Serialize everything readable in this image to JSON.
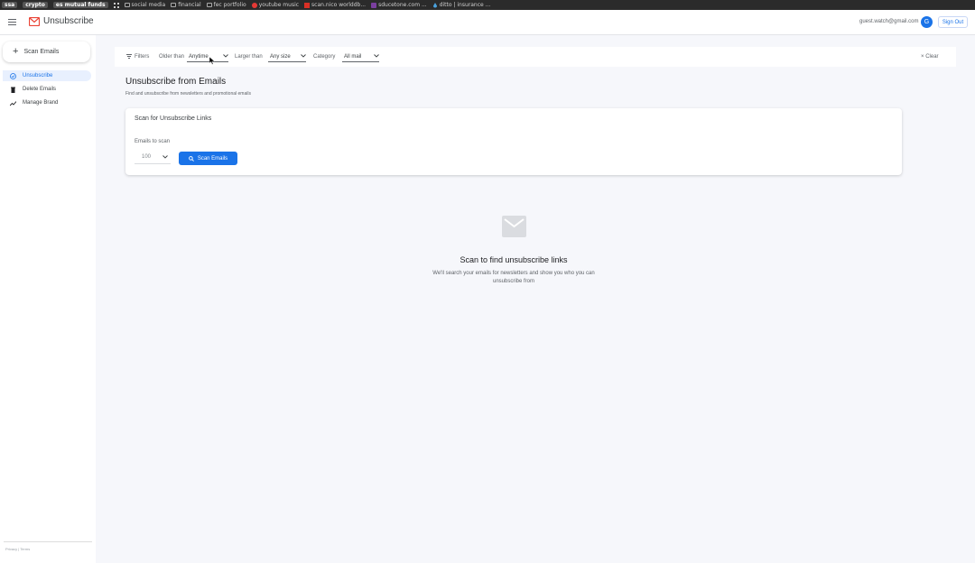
{
  "bookmarks": [
    {
      "label": "ssa",
      "style": "pill"
    },
    {
      "label": "crypto",
      "style": "pill"
    },
    {
      "label": "es mutual funds",
      "style": "pill"
    },
    {
      "label": "",
      "style": "grid"
    },
    {
      "label": "social media",
      "style": "folder"
    },
    {
      "label": "financial",
      "style": "folder"
    },
    {
      "label": "fec portfolio",
      "style": "folder"
    },
    {
      "label": "youtube music",
      "style": "red"
    },
    {
      "label": "scan.nico worlddb...",
      "style": "link"
    },
    {
      "label": "sducetone.com ...",
      "style": "purple"
    },
    {
      "label": "ditto | insurance ...",
      "style": "drop"
    }
  ],
  "header": {
    "title": "Unsubscribe",
    "user_email": "guest.watch@gmail.com",
    "avatar_letter": "G",
    "signout_label": "Sign Out"
  },
  "sidebar": {
    "scan_button": "Scan Emails",
    "items": [
      {
        "label": "Unsubscribe",
        "icon": "circle-check-icon",
        "active": true
      },
      {
        "label": "Delete Emails",
        "icon": "trash-icon",
        "active": false
      },
      {
        "label": "Manage Brand",
        "icon": "trend-icon",
        "active": false
      }
    ],
    "footer": "Privacy | Terms"
  },
  "filters": {
    "label": "Filters",
    "older_than_label": "Older than",
    "older_than_value": "Anytime",
    "larger_than_label": "Larger than",
    "larger_than_value": "Any size",
    "category_label": "Category",
    "category_value": "All mail",
    "clear_label": "Clear"
  },
  "main": {
    "title": "Unsubscribe from Emails",
    "subtitle": "Find and unsubscribe from newsletters and promotional emails",
    "card_title": "Scan for Unsubscribe Links",
    "emails_to_scan_label": "Emails to scan",
    "emails_to_scan_value": "100",
    "scan_button": "Scan Emails"
  },
  "empty_state": {
    "title": "Scan to find unsubscribe links",
    "subtitle": "We'll search your emails for newsletters and show you who you can unsubscribe from"
  },
  "colors": {
    "accent": "#1a73e8",
    "active_bg": "#e8f0fe",
    "brand_red": "#ea4335"
  }
}
